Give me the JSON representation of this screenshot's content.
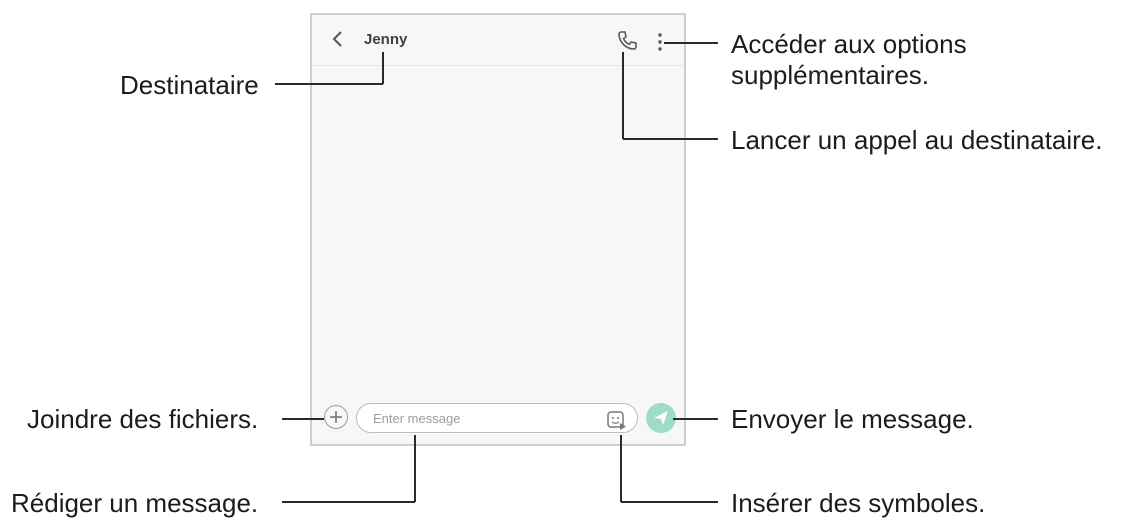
{
  "conversation": {
    "contact_name": "Jenny"
  },
  "composer": {
    "placeholder": "Enter message"
  },
  "callouts": {
    "recipient": "Destinataire",
    "more_options_line1": "Accéder aux options",
    "more_options_line2": "supplémentaires.",
    "call_recipient": "Lancer un appel au destinataire.",
    "attach_files": "Joindre des fichiers.",
    "send_message": "Envoyer le message.",
    "write_message": "Rédiger un message.",
    "insert_symbols": "Insérer des symboles."
  },
  "colors": {
    "send_button": "#9edcc8",
    "screen_background": "#f7f7f7",
    "frame_border": "#cfcfcf"
  },
  "icons": [
    "back-arrow-icon",
    "phone-icon",
    "more-options-icon",
    "plus-icon",
    "sticker-icon",
    "send-icon"
  ]
}
